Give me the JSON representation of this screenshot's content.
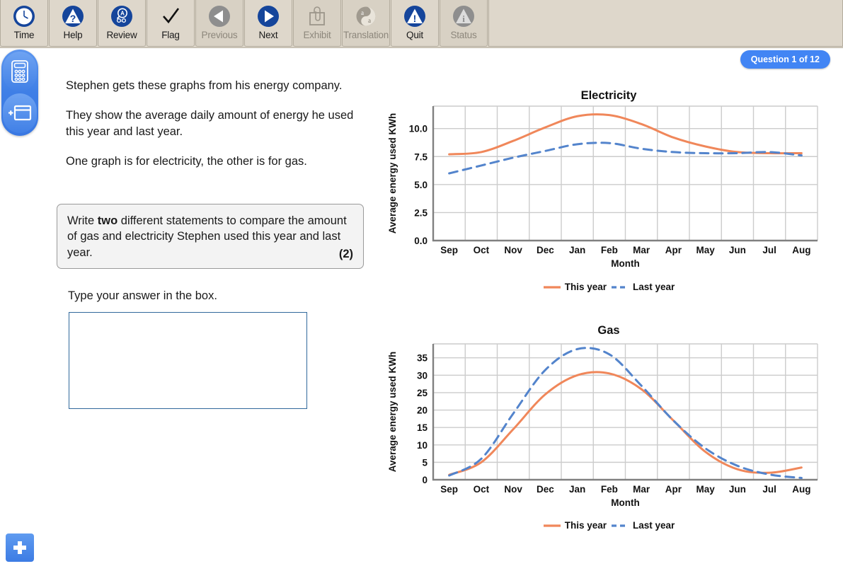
{
  "toolbar": {
    "buttons": [
      {
        "label": "Time",
        "icon": "clock-icon",
        "enabled": true
      },
      {
        "label": "Help",
        "icon": "help-icon",
        "enabled": true
      },
      {
        "label": "Review",
        "icon": "review-icon",
        "enabled": true
      },
      {
        "label": "Flag",
        "icon": "flag-check-icon",
        "enabled": true
      },
      {
        "label": "Previous",
        "icon": "previous-icon",
        "enabled": false
      },
      {
        "label": "Next",
        "icon": "next-icon",
        "enabled": true
      },
      {
        "label": "Exhibit",
        "icon": "exhibit-icon",
        "enabled": false
      },
      {
        "label": "Translation",
        "icon": "translation-icon",
        "enabled": false
      },
      {
        "label": "Quit",
        "icon": "quit-icon",
        "enabled": true
      },
      {
        "label": "Status",
        "icon": "status-icon",
        "enabled": false
      }
    ]
  },
  "tool_rail": {
    "calculator_icon": "calculator-icon",
    "new_window_icon": "add-window-icon",
    "add_note_icon": "plus-icon"
  },
  "header": {
    "question_badge": "Question 1 of 12"
  },
  "stem": {
    "paragraphs": [
      "Stephen gets these graphs from his energy company.",
      "They show the average daily amount of energy he used this year and last year.",
      "One graph is for electricity, the other is for gas."
    ]
  },
  "instruction": {
    "text_before_bold": "Write ",
    "bold": "two",
    "text_after_bold": " different statements to compare the amount of gas and electricity Stephen used this year and last year.",
    "marks": "(2)"
  },
  "answer": {
    "prompt": "Type your answer in the box.",
    "value": "",
    "placeholder": ""
  },
  "colors": {
    "this_year": "#f0875a",
    "last_year": "#5384cc",
    "grid": "#cccccc",
    "axis": "#808080",
    "accent_blue": "#4285f4",
    "toolbar_bg": "#ded7cb"
  },
  "chart_data": [
    {
      "type": "line",
      "title": "Electricity",
      "xlabel": "Month",
      "ylabel": "Average energy used KWh",
      "categories": [
        "Sep",
        "Oct",
        "Nov",
        "Dec",
        "Jan",
        "Feb",
        "Mar",
        "Apr",
        "May",
        "Jun",
        "Jul",
        "Aug"
      ],
      "yticks": [
        0.0,
        2.5,
        5.0,
        7.5,
        10.0
      ],
      "ytick_labels": [
        "0.0",
        "2.5",
        "5.0",
        "7.5",
        "10.0"
      ],
      "ylim": [
        0.0,
        12.0
      ],
      "grid": true,
      "legend_position": "bottom-center",
      "series": [
        {
          "name": "This year",
          "style": "solid",
          "color": "#f0875a",
          "values": [
            7.7,
            7.9,
            8.9,
            10.1,
            11.1,
            11.2,
            10.4,
            9.2,
            8.4,
            7.9,
            7.8,
            7.8
          ]
        },
        {
          "name": "Last year",
          "style": "dashed",
          "color": "#5384cc",
          "values": [
            6.0,
            6.7,
            7.4,
            8.0,
            8.6,
            8.7,
            8.2,
            7.9,
            7.8,
            7.8,
            7.9,
            7.6
          ]
        }
      ]
    },
    {
      "type": "line",
      "title": "Gas",
      "xlabel": "Month",
      "ylabel": "Average energy used KWh",
      "categories": [
        "Sep",
        "Oct",
        "Nov",
        "Dec",
        "Jan",
        "Feb",
        "Mar",
        "Apr",
        "May",
        "Jun",
        "Jul",
        "Aug"
      ],
      "yticks": [
        0,
        5,
        10,
        15,
        20,
        25,
        30,
        35
      ],
      "ytick_labels": [
        "0",
        "5",
        "10",
        "15",
        "20",
        "25",
        "30",
        "35"
      ],
      "ylim": [
        0,
        39
      ],
      "grid": true,
      "legend_position": "bottom-center",
      "series": [
        {
          "name": "This year",
          "style": "solid",
          "color": "#f0875a",
          "values": [
            1.4,
            5.0,
            14.5,
            24.5,
            30.0,
            30.5,
            26.0,
            17.0,
            8.0,
            3.0,
            2.0,
            3.5
          ]
        },
        {
          "name": "Last year",
          "style": "dashed",
          "color": "#5384cc",
          "values": [
            1.2,
            6.0,
            19.0,
            31.5,
            37.5,
            36.0,
            27.0,
            17.0,
            9.0,
            4.0,
            1.5,
            0.5
          ]
        }
      ]
    }
  ],
  "legend_labels": {
    "this_year": "This year",
    "last_year": "Last year"
  }
}
